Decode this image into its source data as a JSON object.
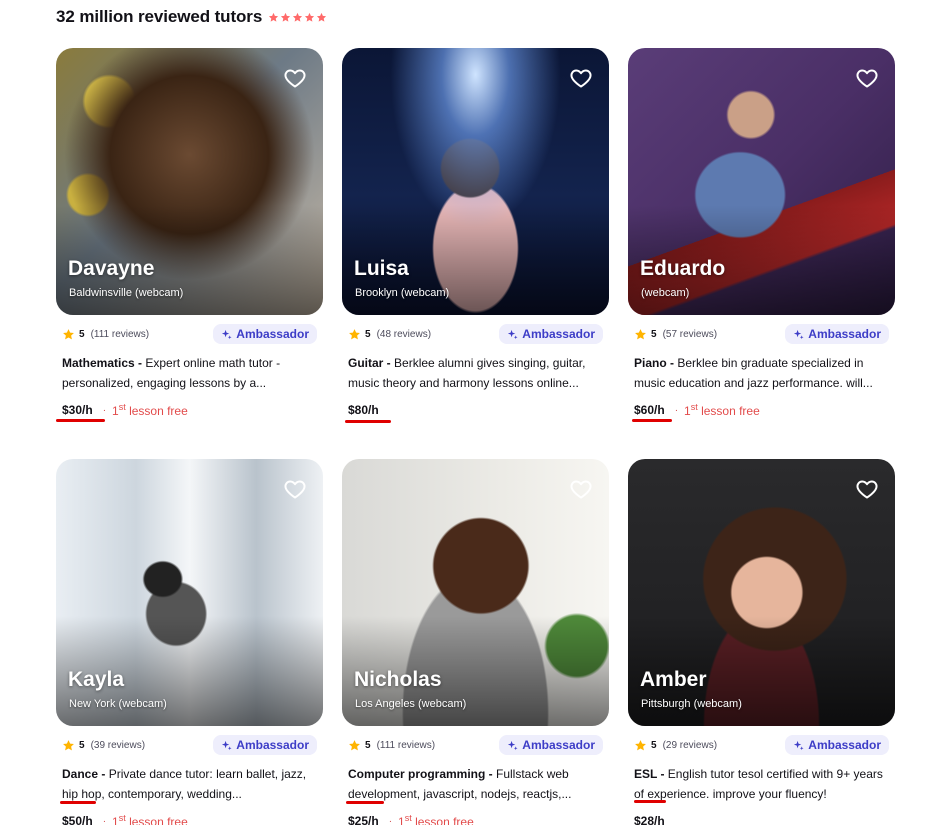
{
  "header": {
    "title": "32 million reviewed tutors",
    "star_color": "#ff6a6a"
  },
  "colors": {
    "accent": "#3d3dc7",
    "badge_bg": "#eeeefc",
    "star": "#ffb400",
    "free": "#e24b4b",
    "annotation": "#e00000"
  },
  "tutors": [
    {
      "name": "Davayne",
      "location": "Baldwinsville (webcam)",
      "score": "5",
      "reviews": "(111 reviews)",
      "badge": "Ambassador",
      "subject": "Mathematics - ",
      "description": "Expert online math tutor - personalized, engaging lessons by a...",
      "price": "$30/h",
      "dot": "·",
      "free_num": "1",
      "free_sup": "st",
      "free_rest": " lesson free"
    },
    {
      "name": "Luisa",
      "location": "Brooklyn (webcam)",
      "score": "5",
      "reviews": "(48 reviews)",
      "badge": "Ambassador",
      "subject": "Guitar - ",
      "description": "Berklee alumni gives singing, guitar, music theory and harmony lessons online...",
      "price": "$80/h",
      "dot": "",
      "free_num": "",
      "free_sup": "",
      "free_rest": ""
    },
    {
      "name": "Eduardo",
      "location": "(webcam)",
      "score": "5",
      "reviews": "(57 reviews)",
      "badge": "Ambassador",
      "subject": "Piano - ",
      "description": "Berklee bin graduate specialized in music education and jazz performance. will...",
      "price": "$60/h",
      "dot": "·",
      "free_num": "1",
      "free_sup": "st",
      "free_rest": " lesson free"
    },
    {
      "name": "Kayla",
      "location": "New York (webcam)",
      "score": "5",
      "reviews": "(39 reviews)",
      "badge": "Ambassador",
      "subject": "Dance - ",
      "description": "Private dance tutor: learn ballet, jazz, hip hop, contemporary, wedding...",
      "price": "$50/h",
      "dot": "·",
      "free_num": "1",
      "free_sup": "st",
      "free_rest": " lesson free"
    },
    {
      "name": "Nicholas",
      "location": "Los Angeles (webcam)",
      "score": "5",
      "reviews": "(111 reviews)",
      "badge": "Ambassador",
      "subject": "Computer programming - ",
      "description": "Fullstack web development, javascript, nodejs, reactjs,...",
      "price": "$25/h",
      "dot": "·",
      "free_num": "1",
      "free_sup": "st",
      "free_rest": " lesson free"
    },
    {
      "name": "Amber",
      "location": "Pittsburgh (webcam)",
      "score": "5",
      "reviews": "(29 reviews)",
      "badge": "Ambassador",
      "subject": "ESL - ",
      "description": "English tutor tesol certified with 9+ years of experience. improve your fluency!",
      "price": "$28/h",
      "dot": "",
      "free_num": "",
      "free_sup": "",
      "free_rest": ""
    }
  ]
}
